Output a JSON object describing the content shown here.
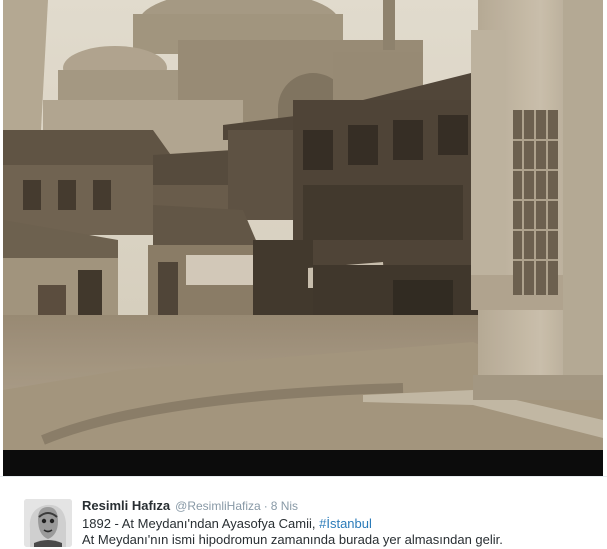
{
  "tweet": {
    "display_name": "Resimli Hafıza",
    "handle": "@ResimliHafiza",
    "separator": "·",
    "timestamp": "8 Nis",
    "text_line1_prefix": "1892 - At Meydanı'ndan Ayasofya Camii, ",
    "hashtag": "#İstanbul",
    "text_line2": "At Meydanı'nın ismi hipodromun zamanında burada yer almasından gelir."
  },
  "photo": {
    "subject": "historic-sepia-photograph",
    "tint": "#8a7a62"
  },
  "avatar": {
    "icon": "portrait-avatar-icon"
  }
}
